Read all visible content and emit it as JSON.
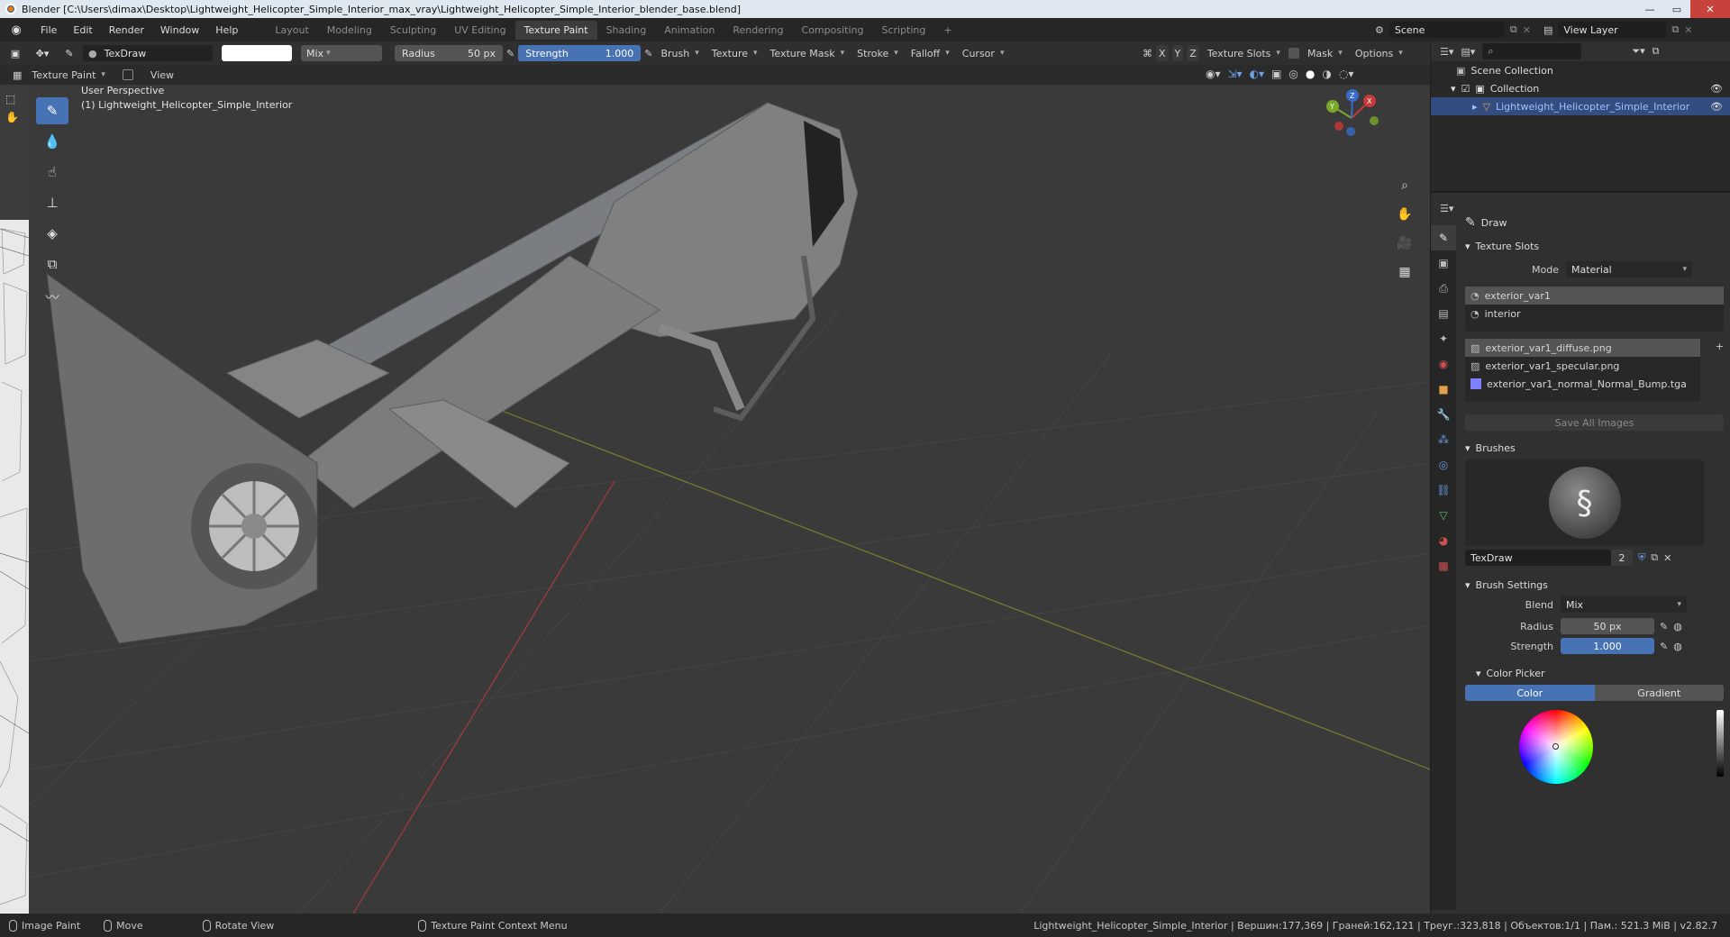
{
  "titlebar": {
    "title": "Blender [C:\\Users\\dimax\\Desktop\\Lightweight_Helicopter_Simple_Interior_max_vray\\Lightweight_Helicopter_Simple_Interior_blender_base.blend]",
    "controls": [
      "—",
      "▭",
      "✕"
    ]
  },
  "menu": [
    "File",
    "Edit",
    "Render",
    "Window",
    "Help"
  ],
  "workspaces": [
    "Layout",
    "Modeling",
    "Sculpting",
    "UV Editing",
    "Texture Paint",
    "Shading",
    "Animation",
    "Rendering",
    "Compositing",
    "Scripting"
  ],
  "active_workspace": "Texture Paint",
  "add_workspace": "+",
  "scene": "Scene",
  "view_layer": "View Layer",
  "toolbar": {
    "brush_name": "TexDraw",
    "blend": "Mix",
    "radius_label": "Radius",
    "radius_value": "50 px",
    "strength_label": "Strength",
    "strength_value": "1.000",
    "menus": [
      "Brush",
      "Texture",
      "Texture Mask",
      "Stroke",
      "Falloff",
      "Cursor"
    ],
    "axes": [
      "X",
      "Y",
      "Z"
    ],
    "texture_slots": "Texture Slots",
    "mask": "Mask",
    "options": "Options"
  },
  "header2": {
    "mode": "Texture Paint",
    "view": "View"
  },
  "viewport": {
    "perspective": "User Perspective",
    "object": "(1) Lightweight_Helicopter_Simple_Interior",
    "gizmo": {
      "x": "X",
      "y": "Y",
      "z": "Z"
    },
    "colors": {
      "bg": "#3a3a3a",
      "model": "#7b7b7b",
      "grid": "#444444",
      "x_axis": "#a83a3a",
      "y_axis": "#7c7e2e"
    }
  },
  "outliner": {
    "scene_collection": "Scene Collection",
    "collection": "Collection",
    "object": "Lightweight_Helicopter_Simple_Interior"
  },
  "properties": {
    "tool": "Draw",
    "texture_slots": {
      "title": "Texture Slots",
      "mode_label": "Mode",
      "mode_value": "Material",
      "materials": [
        "exterior_var1",
        "interior"
      ],
      "images": [
        "exterior_var1_diffuse.png",
        "exterior_var1_specular.png",
        "exterior_var1_normal_Normal_Bump.tga"
      ],
      "save_all": "Save All Images"
    },
    "brushes": {
      "title": "Brushes",
      "brush_name": "TexDraw",
      "users": "2"
    },
    "brush_settings": {
      "title": "Brush Settings",
      "blend_label": "Blend",
      "blend_value": "Mix",
      "radius_label": "Radius",
      "radius_value": "50 px",
      "strength_label": "Strength",
      "strength_value": "1.000"
    },
    "color_picker": {
      "title": "Color Picker",
      "tabs": [
        "Color",
        "Gradient"
      ]
    }
  },
  "statusbar": {
    "left": [
      "Image Paint",
      "Move",
      "Rotate View",
      "Texture Paint Context Menu"
    ],
    "stats": "Lightweight_Helicopter_Simple_Interior | Вершин:177,369 | Граней:162,121 | Треуг.:323,818 | Объектов:1/1 | Пам.: 521.3 MiB | v2.82.7"
  }
}
